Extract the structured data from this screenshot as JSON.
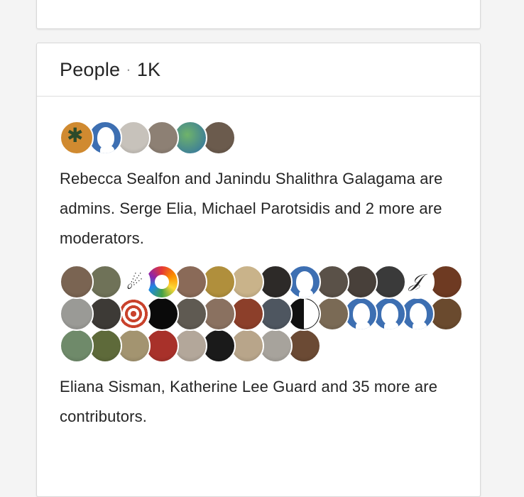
{
  "people_card": {
    "title": "People",
    "separator": "·",
    "count": "1K",
    "admins_text": "Rebecca Sealfon and Janindu Shalithra Galagama are admins. Serge Elia, Michael Parotsidis and 2 more are moderators.",
    "contributors_text": "Eliana Sisman, Katherine Lee Guard and 35 more are contributors.",
    "admin_avatars": [
      {
        "name": "maple-leaf-avatar",
        "kind": "leaf",
        "color": "#d08a30"
      },
      {
        "name": "default-user-avatar",
        "kind": "ph",
        "color": "#3d6fb2"
      },
      {
        "name": "user-avatar",
        "kind": "photo",
        "color": "#c7c2bb"
      },
      {
        "name": "user-avatar",
        "kind": "photo",
        "color": "#8d8074"
      },
      {
        "name": "globe-avatar",
        "kind": "globe",
        "color": "#4a8a8a"
      },
      {
        "name": "user-avatar",
        "kind": "photo",
        "color": "#6b5b4d"
      }
    ],
    "contributor_avatars": [
      {
        "name": "user-avatar",
        "kind": "photo",
        "color": "#7a6452"
      },
      {
        "name": "user-avatar",
        "kind": "photo",
        "color": "#6f7258"
      },
      {
        "name": "rocket-avatar",
        "kind": "rocket",
        "color": "#ffffff"
      },
      {
        "name": "rainbow-avatar",
        "kind": "rainbow",
        "color": "#e53935"
      },
      {
        "name": "user-avatar",
        "kind": "photo",
        "color": "#8a6a58"
      },
      {
        "name": "user-avatar",
        "kind": "photo",
        "color": "#b08f3c"
      },
      {
        "name": "user-avatar",
        "kind": "photo",
        "color": "#c9b38a"
      },
      {
        "name": "user-avatar",
        "kind": "photo",
        "color": "#2d2a28"
      },
      {
        "name": "default-user-avatar",
        "kind": "ph",
        "color": "#3d6fb2"
      },
      {
        "name": "user-avatar",
        "kind": "photo",
        "color": "#5a5148"
      },
      {
        "name": "user-avatar",
        "kind": "photo",
        "color": "#48403a"
      },
      {
        "name": "user-avatar",
        "kind": "photo",
        "color": "#3a3a3a"
      },
      {
        "name": "signature-avatar",
        "kind": "sig",
        "color": "#ffffff"
      },
      {
        "name": "user-avatar",
        "kind": "photo",
        "color": "#6e3a22"
      },
      {
        "name": "user-avatar",
        "kind": "photo",
        "color": "#9a9a96"
      },
      {
        "name": "user-avatar",
        "kind": "photo",
        "color": "#3d3a36"
      },
      {
        "name": "target-avatar",
        "kind": "target",
        "color": "#c9422c"
      },
      {
        "name": "user-avatar",
        "kind": "black",
        "color": "#0a0a0a"
      },
      {
        "name": "user-avatar",
        "kind": "photo",
        "color": "#5f5a52"
      },
      {
        "name": "user-avatar",
        "kind": "photo",
        "color": "#8a7160"
      },
      {
        "name": "user-avatar",
        "kind": "photo",
        "color": "#8c3f2a"
      },
      {
        "name": "user-avatar",
        "kind": "photo",
        "color": "#4e5660"
      },
      {
        "name": "yin-yang-avatar",
        "kind": "yinyang",
        "color": "#111111"
      },
      {
        "name": "user-avatar",
        "kind": "photo",
        "color": "#7a6a55"
      },
      {
        "name": "default-user-avatar",
        "kind": "ph",
        "color": "#3d6fb2"
      },
      {
        "name": "default-user-avatar",
        "kind": "ph",
        "color": "#3d6fb2"
      },
      {
        "name": "default-user-avatar",
        "kind": "ph",
        "color": "#3d6fb2"
      },
      {
        "name": "user-avatar",
        "kind": "photo",
        "color": "#6a4a2e"
      },
      {
        "name": "user-avatar",
        "kind": "photo",
        "color": "#6f8a6a"
      },
      {
        "name": "user-avatar",
        "kind": "photo",
        "color": "#5e6a3a"
      },
      {
        "name": "user-avatar",
        "kind": "photo",
        "color": "#a39470"
      },
      {
        "name": "user-avatar",
        "kind": "photo",
        "color": "#a8312a"
      },
      {
        "name": "user-avatar",
        "kind": "photo",
        "color": "#b3a79a"
      },
      {
        "name": "user-avatar",
        "kind": "photo",
        "color": "#1a1a1a"
      },
      {
        "name": "user-avatar",
        "kind": "photo",
        "color": "#b8a58a"
      },
      {
        "name": "user-avatar",
        "kind": "photo",
        "color": "#a7a39c"
      },
      {
        "name": "user-avatar",
        "kind": "photo",
        "color": "#6b4a34"
      }
    ]
  }
}
